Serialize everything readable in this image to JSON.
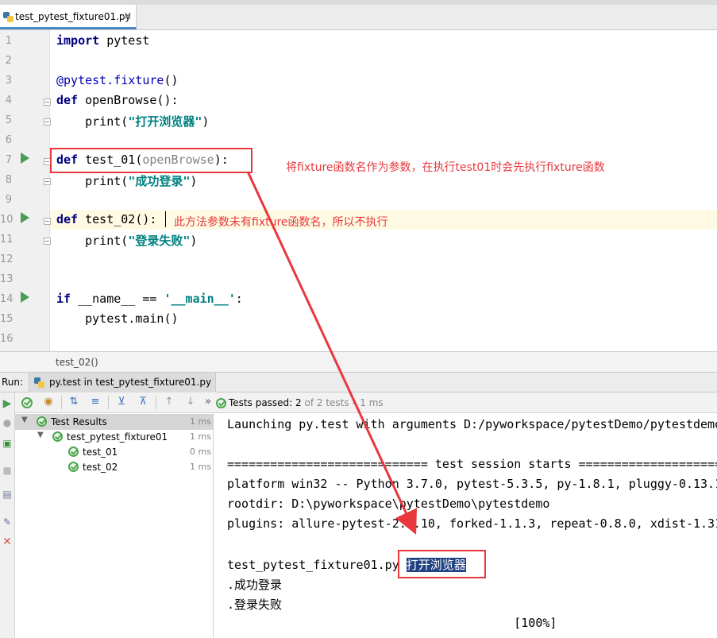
{
  "tabs": {
    "active_tab_label": "test_pytest_fixture01.py",
    "close_glyph": "×"
  },
  "editor": {
    "lines": [
      {
        "num": "1",
        "text": "import pytest"
      },
      {
        "num": "2",
        "text": ""
      },
      {
        "num": "3",
        "text": "@pytest.fixture()"
      },
      {
        "num": "4",
        "text": "def openBrowse():"
      },
      {
        "num": "5",
        "text": "    print(\"打开浏览器\")"
      },
      {
        "num": "6",
        "text": ""
      },
      {
        "num": "7",
        "text": "def test_01(openBrowse):"
      },
      {
        "num": "8",
        "text": "    print(\"成功登录\")"
      },
      {
        "num": "9",
        "text": ""
      },
      {
        "num": "10",
        "text": "def test_02():"
      },
      {
        "num": "11",
        "text": "    print(\"登录失败\")"
      },
      {
        "num": "12",
        "text": ""
      },
      {
        "num": "13",
        "text": ""
      },
      {
        "num": "14",
        "text": "if __name__ == '__main__':"
      },
      {
        "num": "15",
        "text": "    pytest.main()"
      },
      {
        "num": "16",
        "text": ""
      }
    ],
    "code": {
      "import_kw": "import",
      "import_mod": " pytest",
      "decorator": "@pytest.fixture",
      "decorator_parens": "()",
      "def_kw": "def",
      "fixture_name": " openBrowse():",
      "print_kw": "    print(",
      "str_browser": "\"打开浏览器\"",
      "close_paren": ")",
      "test01_name": " test_01(",
      "test01_param": "openBrowse",
      "test01_tail": "):",
      "str_login_ok": "\"成功登录\"",
      "test02_name": " test_02():",
      "str_login_fail": "\"登录失败\"",
      "if_kw": "if",
      "main_cond_a": " __name__ == ",
      "main_str": "'__main__'",
      "main_colon": ":",
      "main_call": "    pytest.main()"
    }
  },
  "annotations": {
    "note_fixture": "将fixture函数名作为参数，在执行test01时会先执行fixture函数",
    "note_no_fixture": "此方法参数未有fixture函数名，所以不执行"
  },
  "breadcrumb": "test_02()",
  "run_window": {
    "run_label": "Run:",
    "tab_label": "py.test in test_pytest_fixture01.py",
    "status_prefix": "Tests passed: ",
    "status_count": "2",
    "status_suffix": " of 2 tests – 1 ms",
    "more_glyph": "»"
  },
  "test_tree": [
    {
      "label": "Test Results",
      "duration": "1 ms"
    },
    {
      "label": "test_pytest_fixture01",
      "duration": "1 ms"
    },
    {
      "label": "test_01",
      "duration": "0 ms"
    },
    {
      "label": "test_02",
      "duration": "1 ms"
    }
  ],
  "console": {
    "lines": [
      "Launching py.test with arguments D:/pyworkspace/pytestDemo/pytestdemo",
      "",
      "============================ test session starts ====================",
      "platform win32 -- Python 3.7.0, pytest-5.3.5, py-1.8.1, pluggy-0.13.1",
      "rootdir: D:\\pyworkspace\\pytestDemo\\pytestdemo",
      "plugins: allure-pytest-2.8.10, forked-1.1.3, repeat-0.8.0, xdist-1.31",
      "",
      "test_pytest_fixture01.py ",
      ".成功登录",
      ".登录失败",
      "                                        [100%]"
    ],
    "highlighted_output": "打开浏览器"
  },
  "colors": {
    "annotation_red": "#e8383d",
    "pass_green": "#4ca64c",
    "keyword_navy": "#000080",
    "string_teal": "#008080",
    "selection_blue": "#214283"
  }
}
